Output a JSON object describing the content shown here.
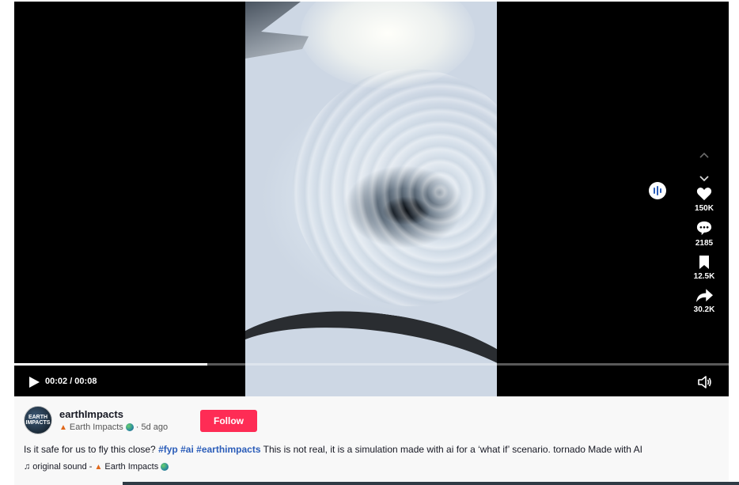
{
  "player": {
    "time_display": "00:02 / 00:08",
    "progress_fraction": 0.27
  },
  "actions": {
    "likes": "150K",
    "comments": "2185",
    "bookmarks": "12.5K",
    "shares": "30.2K"
  },
  "author": {
    "username": "earthImpacts",
    "display_name": "Earth Impacts",
    "posted": "· 5d ago",
    "avatar_text": "EARTH IMPACTS"
  },
  "follow_label": "Follow",
  "caption": {
    "intro": "Is it safe for us to fly this close? ",
    "tags": [
      "#fyp",
      "#ai",
      "#earthimpacts"
    ],
    "text": " This is not real, it is a simulation made with ai for a ‘what if’ scenario. tornado Made with AI"
  },
  "sound": {
    "icon": "music-note-icon",
    "label": "original sound - ",
    "author": "Earth Impacts"
  },
  "colors": {
    "follow": "#fe2c55",
    "hashtag": "#2b5db9"
  }
}
